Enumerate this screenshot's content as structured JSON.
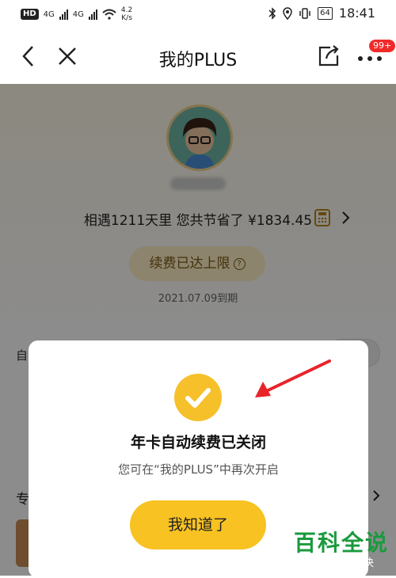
{
  "status_bar": {
    "hd": "HD",
    "net1": "4G",
    "net2": "4G",
    "speed_value": "4.2",
    "speed_unit": "K/s",
    "battery": "64",
    "time": "18:41"
  },
  "nav": {
    "title": "我的PLUS",
    "badge": "99+"
  },
  "page": {
    "savings_text": "相遇1211天里 您共节省了 ¥1834.45",
    "renew_label": "续费已达上限",
    "help_mark": "?",
    "expire_date": "2021.07.09到期",
    "auto_label": "自",
    "section_label": "专"
  },
  "dialog": {
    "title": "年卡自动续费已关闭",
    "subtitle": "您可在“我的PLUS”中再次开启",
    "confirm_label": "我知道了"
  },
  "watermark": {
    "title": "百科全说",
    "subtitle": "助你轻松解决"
  },
  "colors": {
    "accent_yellow": "#f7c222",
    "arrow_red": "#e8232a",
    "badge_red": "#f02a2a",
    "watermark_green": "#1a9a3d"
  }
}
